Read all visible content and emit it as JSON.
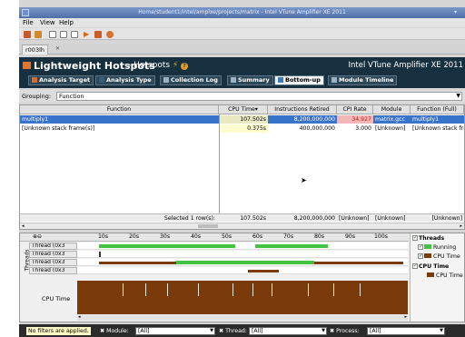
{
  "window": {
    "title": "Home/student1/intel/amplxe/projects/matrix - Intel VTune Amplifier XE 2011"
  },
  "menu": [
    "File",
    "View",
    "Help"
  ],
  "result_tab": {
    "label": "r003lh",
    "close": "✕"
  },
  "header": {
    "title": "Lightweight Hotspots",
    "subtitle": "- Hotspots",
    "brand": "Intel VTune Amplifier XE 2011",
    "help_glyph": "?",
    "tabs": [
      "Analysis Target",
      "Analysis Type",
      "Collection Log",
      "Summary",
      "Bottom-up",
      "Module Timeline"
    ],
    "active_tab": "Bottom-up"
  },
  "grouping": {
    "label": "Grouping:",
    "value": "Function"
  },
  "grid": {
    "columns": [
      "Function",
      "CPU Time",
      "Instructions Retired",
      "CPI Rate",
      "Module",
      "Function (Full)"
    ],
    "rows": [
      {
        "function": "multiply1",
        "cpu_time": "107.502s",
        "instructions": "8,200,000,000",
        "cpi": "34.927",
        "module": "matrix.gcc",
        "full": "multiply1"
      },
      {
        "function": "[Unknown stack frame(s)]",
        "cpu_time": "0.375s",
        "instructions": "400,000,000",
        "cpi": "3.000",
        "module": "[Unknown]",
        "full": "[Unknown stack frame(s)]"
      }
    ],
    "summary": {
      "selected": "Selected 1 row(s):",
      "cpu_time": "107.502s",
      "instructions": "8,200,000,000",
      "module": "[Unknown]",
      "module2": "[Unknown]",
      "full": "[Unknown]"
    }
  },
  "timeline": {
    "axis_label": "Threads",
    "ticks": [
      "10s",
      "20s",
      "30s",
      "40s",
      "50s",
      "60s",
      "70s",
      "80s",
      "90s",
      "100s"
    ],
    "threads": [
      "Thread (0x3",
      "Thread (0x3",
      "Thread (0x3",
      "Thread (0x3"
    ],
    "cpu_label": "CPU Time",
    "legend": {
      "threads_header": "Threads",
      "running": "Running",
      "cpu_time": "CPU Time",
      "cpu_header": "CPU Time",
      "cpu_time2": "CPU Time"
    },
    "colors": {
      "running": "#44c244",
      "cpu": "#7a3a0a",
      "header": "#17303f"
    }
  },
  "filter": {
    "message": "No filters are applied.",
    "module_label": "Module:",
    "module_value": "[All]",
    "thread_label": "Thread:",
    "thread_value": "[All]",
    "process_label": "Process:",
    "process_value": "[All]"
  }
}
